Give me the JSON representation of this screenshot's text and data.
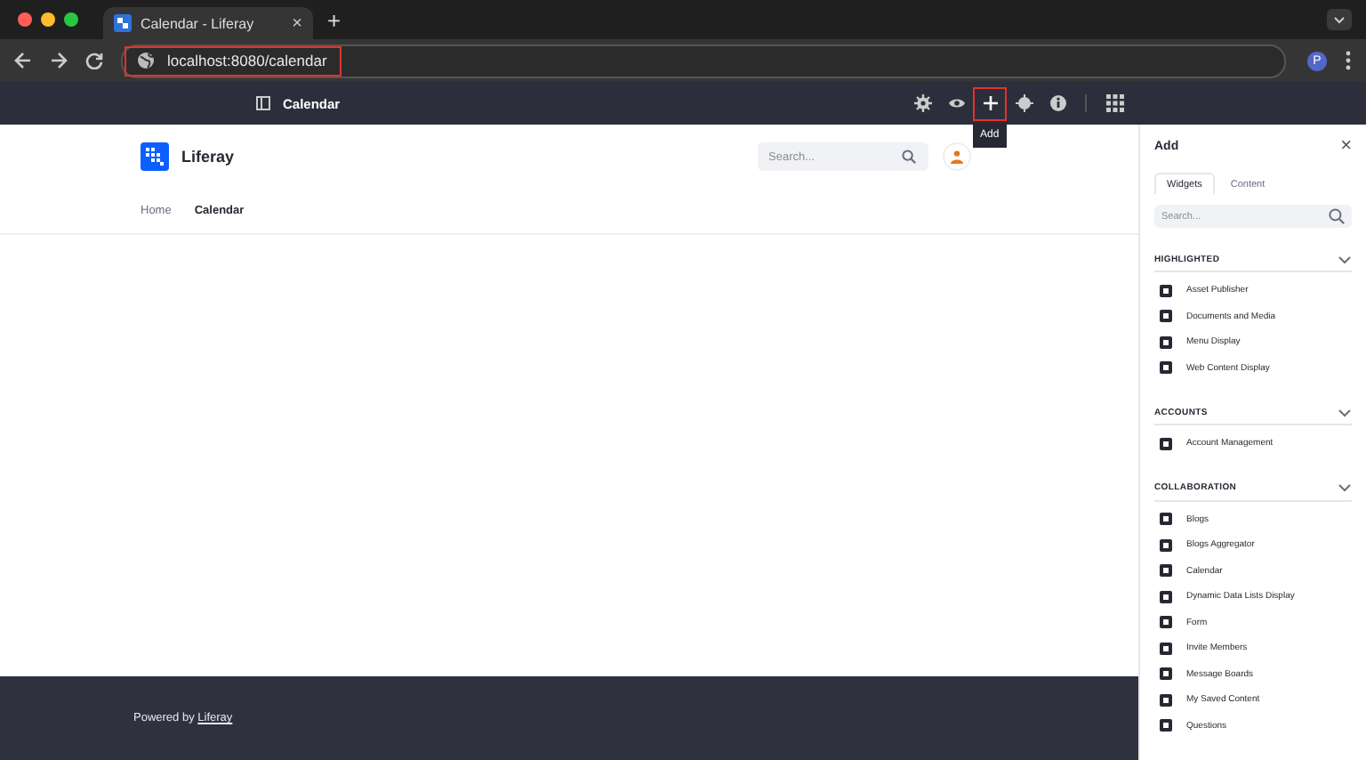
{
  "browser": {
    "tab_title": "Calendar - Liferay",
    "tab_close": "×",
    "new_tab": "+",
    "url": "localhost:8080/calendar",
    "url_highlighted": true,
    "profile_initial": "P"
  },
  "control_bar": {
    "page_title": "Calendar",
    "tools": [
      {
        "kind": "gear",
        "highlighted": false
      },
      {
        "kind": "eye",
        "highlighted": false
      },
      {
        "kind": "plus",
        "highlighted": true
      },
      {
        "kind": "target",
        "highlighted": false
      },
      {
        "kind": "info",
        "highlighted": false
      },
      {
        "kind": "grid",
        "highlighted": false
      }
    ],
    "tooltip": "Add"
  },
  "site": {
    "logo_text": "Liferay",
    "search": {
      "placeholder": "Search..."
    },
    "nav": [
      {
        "label": "Home",
        "selected": false
      },
      {
        "label": "Calendar",
        "selected": true
      }
    ],
    "footer": {
      "text": "Powered by ",
      "link": "Liferay"
    }
  },
  "panel": {
    "title": "Add",
    "close": "×",
    "tabs": [
      {
        "label": "Widgets",
        "selected": true
      },
      {
        "label": "Content",
        "selected": false
      }
    ],
    "search": {
      "placeholder": "Search..."
    },
    "sections": [
      {
        "title": "HIGHLIGHTED",
        "expanded": true,
        "items": [
          "Asset Publisher",
          "Documents and Media",
          "Menu Display",
          "Web Content Display"
        ]
      },
      {
        "title": "ACCOUNTS",
        "expanded": true,
        "items": [
          "Account Management"
        ]
      },
      {
        "title": "COLLABORATION",
        "expanded": true,
        "items": [
          "Blogs",
          "Blogs Aggregator",
          "Calendar",
          "Dynamic Data Lists Display",
          "Form",
          "Invite Members",
          "Message Boards",
          "My Saved Content",
          "Questions"
        ]
      }
    ]
  }
}
